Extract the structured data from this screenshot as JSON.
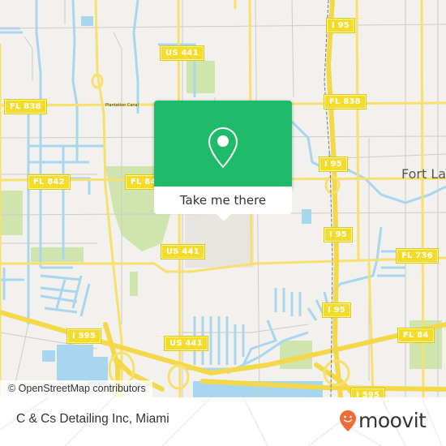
{
  "map": {
    "attribution": "© OpenStreetMap contributors",
    "city_label": "Fort La",
    "street_label": "Plantation Canal",
    "road_shields": [
      {
        "id": "us441-top",
        "text": "US 441"
      },
      {
        "id": "fl838-left",
        "text": "FL 838"
      },
      {
        "id": "fl838-right",
        "text": "FL 838"
      },
      {
        "id": "i95-top",
        "text": "I 95"
      },
      {
        "id": "fl842-left",
        "text": "FL 842"
      },
      {
        "id": "fl842-mid",
        "text": "FL 84"
      },
      {
        "id": "i95-mid",
        "text": "I 95"
      },
      {
        "id": "us441-mid",
        "text": "US 441"
      },
      {
        "id": "i95-lower",
        "text": "I 95"
      },
      {
        "id": "fl736",
        "text": "FL 736"
      },
      {
        "id": "i95-bottom",
        "text": "I 95"
      },
      {
        "id": "fl84",
        "text": "FL 84"
      },
      {
        "id": "i595-left",
        "text": "I 595"
      },
      {
        "id": "us441-bottom",
        "text": "US 441"
      },
      {
        "id": "i595-right",
        "text": "I 595"
      }
    ],
    "colors": {
      "land": "#f2f1ed",
      "water": "#a9d6ef",
      "road_major": "#f7e06e",
      "park": "#cde6a8",
      "popup_green": "#1fba6a"
    }
  },
  "popup": {
    "button_label": "Take me there"
  },
  "footer": {
    "place_name": "C & Cs Detailing Inc, Miami",
    "brand": "moovit",
    "brand_color": "#f26a36"
  }
}
